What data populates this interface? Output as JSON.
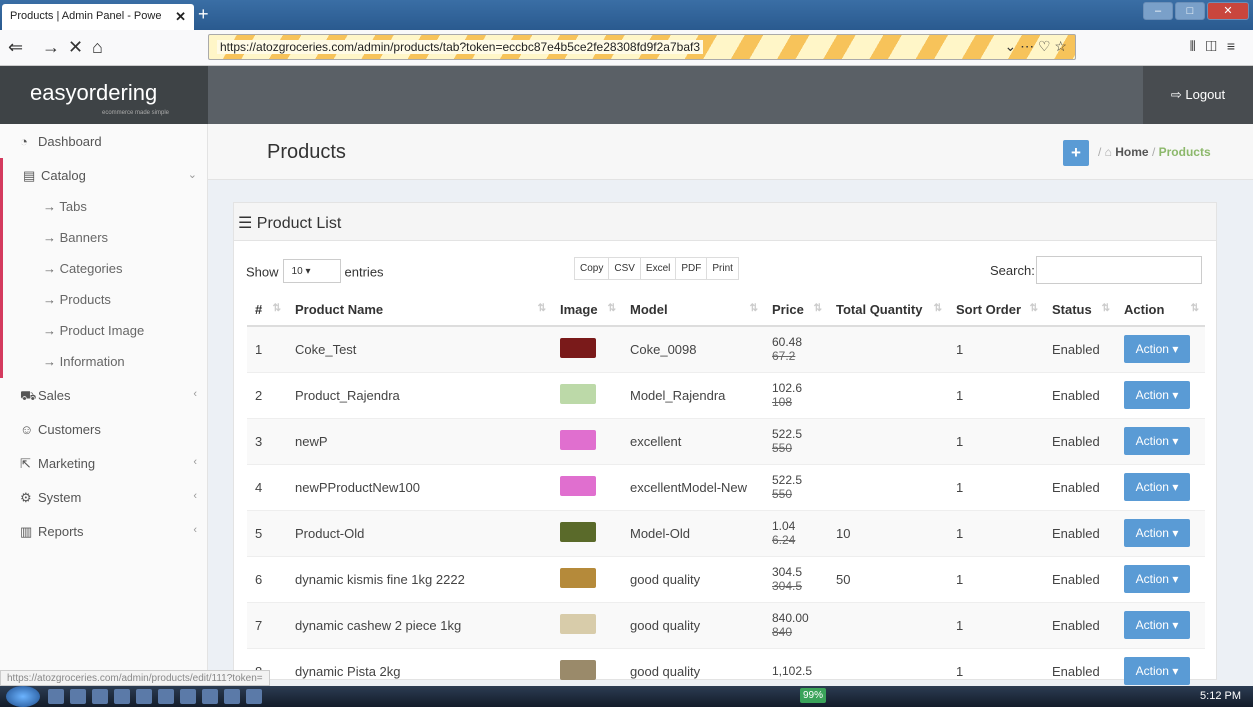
{
  "browser": {
    "tab_title": "Products | Admin Panel - Powe",
    "url": "https://atozgroceries.com/admin/products/tab?token=eccbc87e4b5ce2fe28308fd9f2a7baf3"
  },
  "app": {
    "logo": "easyordering",
    "logo_sub": "ecommerce made simple",
    "logout": "Logout"
  },
  "sidebar": {
    "items": [
      {
        "label": "Dashboard",
        "icon": "dashboard-icon"
      },
      {
        "label": "Catalog",
        "icon": "catalog-icon"
      },
      {
        "label": "Tabs"
      },
      {
        "label": "Banners"
      },
      {
        "label": "Categories"
      },
      {
        "label": "Products"
      },
      {
        "label": "Product Image"
      },
      {
        "label": "Information"
      },
      {
        "label": "Sales",
        "icon": "cart-icon"
      },
      {
        "label": "Customers",
        "icon": "user-icon"
      },
      {
        "label": "Marketing",
        "icon": "share-icon"
      },
      {
        "label": "System",
        "icon": "gear-icon"
      },
      {
        "label": "Reports",
        "icon": "chart-icon"
      }
    ]
  },
  "page": {
    "title": "Products",
    "breadcrumb_home": "Home",
    "breadcrumb_current": "Products"
  },
  "panel": {
    "title": "Product List",
    "show": "Show",
    "entries_value": "10",
    "entries": "entries",
    "search": "Search:",
    "buttons": [
      "Copy",
      "CSV",
      "Excel",
      "PDF",
      "Print"
    ]
  },
  "table": {
    "headers": [
      "#",
      "Product Name",
      "Image",
      "Model",
      "Price",
      "Total Quantity",
      "Sort Order",
      "Status",
      "Action"
    ],
    "rows": [
      {
        "n": "1",
        "name": "Coke_Test",
        "model": "Coke_0098",
        "price": "60.48",
        "old": "67.2",
        "qty": "",
        "sort": "1",
        "status": "Enabled",
        "color": "#7a1a1a"
      },
      {
        "n": "2",
        "name": "Product_Rajendra",
        "model": "Model_Rajendra",
        "price": "102.6",
        "old": "108",
        "qty": "",
        "sort": "1",
        "status": "Enabled",
        "color": "#bcd9a8"
      },
      {
        "n": "3",
        "name": "newP",
        "model": "excellent",
        "price": "522.5",
        "old": "550",
        "qty": "",
        "sort": "1",
        "status": "Enabled",
        "color": "#e06fcf"
      },
      {
        "n": "4",
        "name": "newPProductNew100",
        "model": "excellentModel-New",
        "price": "522.5",
        "old": "550",
        "qty": "",
        "sort": "1",
        "status": "Enabled",
        "color": "#e06fcf"
      },
      {
        "n": "5",
        "name": "Product-Old",
        "model": "Model-Old",
        "price": "1.04",
        "old": "6.24",
        "qty": "10",
        "sort": "1",
        "status": "Enabled",
        "color": "#5a6a2a"
      },
      {
        "n": "6",
        "name": "dynamic kismis fine 1kg 2222",
        "model": "good quality",
        "price": "304.5",
        "old": "304.5",
        "qty": "50",
        "sort": "1",
        "status": "Enabled",
        "color": "#b58a3a"
      },
      {
        "n": "7",
        "name": "dynamic cashew 2 piece 1kg",
        "model": "good quality",
        "price": "840.00",
        "old": "840",
        "qty": "",
        "sort": "1",
        "status": "Enabled",
        "color": "#d8ccaa"
      },
      {
        "n": "8",
        "name": "dynamic Pista 2kg",
        "model": "good quality",
        "price": "1,102.5",
        "old": "",
        "qty": "",
        "sort": "1",
        "status": "Enabled",
        "color": "#9a8a6a"
      }
    ],
    "action": "Action"
  },
  "status_url": "https://atozgroceries.com/admin/products/edit/111?token=",
  "taskbar": {
    "clock": "5:12 PM",
    "battery": "99%"
  }
}
